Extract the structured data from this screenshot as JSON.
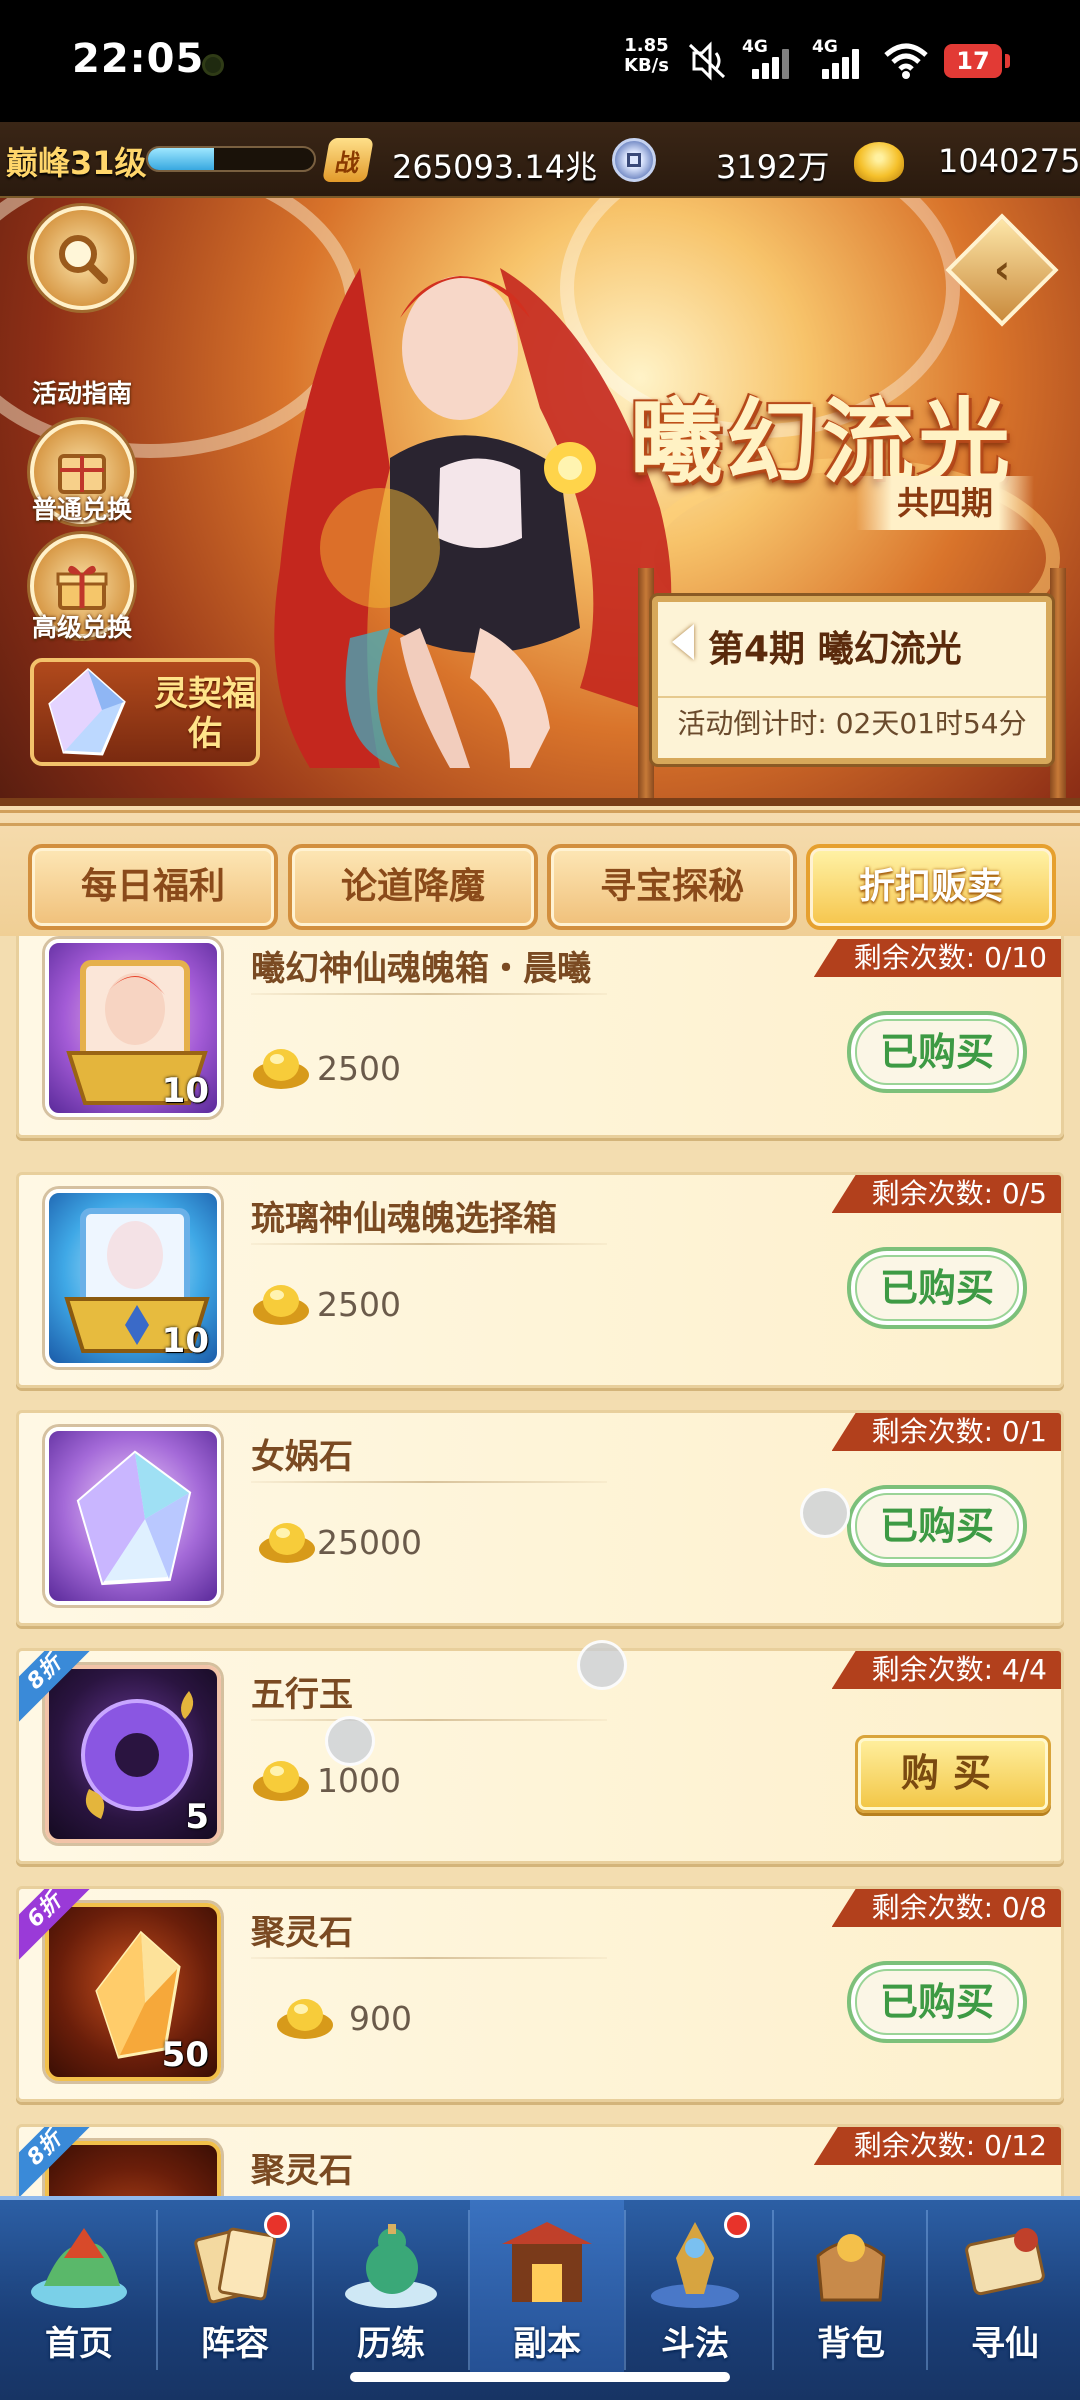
{
  "status_bar": {
    "time": "22:05",
    "net_speed_value": "1.85",
    "net_speed_unit": "KB/s",
    "sim1_label": "4G",
    "sim2_label": "4G",
    "battery": "17"
  },
  "resources": {
    "level": "巅峰31级",
    "exp_fraction": 0.4,
    "power_icon": "战",
    "power": "265093.14兆",
    "silver": "3192万",
    "gold": "1040275"
  },
  "banner": {
    "side_buttons": [
      "活动指南",
      "普通兑换",
      "高级兑换"
    ],
    "lingqi": "灵契福佑",
    "event_title": "曦幻流光",
    "event_sub": "共四期",
    "period_title": "第4期  曦幻流光",
    "countdown": "活动倒计时: 02天01时54分"
  },
  "tabs": [
    "每日福利",
    "论道降魔",
    "寻宝探秘",
    "折扣贩卖"
  ],
  "active_tab": 3,
  "items": [
    {
      "name": "曦幻神仙魂魄箱・晨曦",
      "price": "2500",
      "remain": "剩余次数: 0/10",
      "qty": "10",
      "button": "已购买",
      "discount": ""
    },
    {
      "name": "琉璃神仙魂魄选择箱",
      "price": "2500",
      "remain": "剩余次数: 0/5",
      "qty": "10",
      "button": "已购买",
      "discount": ""
    },
    {
      "name": "女娲石",
      "price": "25000",
      "remain": "剩余次数: 0/1",
      "qty": "",
      "button": "已购买",
      "discount": ""
    },
    {
      "name": "五行玉",
      "price": "1000",
      "remain": "剩余次数: 4/4",
      "qty": "5",
      "button": "购买",
      "discount": "8折"
    },
    {
      "name": "聚灵石",
      "price": "900",
      "remain": "剩余次数: 0/8",
      "qty": "50",
      "button": "已购买",
      "discount": "6折"
    },
    {
      "name": "聚灵石",
      "price": "",
      "remain": "剩余次数: 0/12",
      "qty": "",
      "button": "",
      "discount": "8折"
    }
  ],
  "nav": [
    "首页",
    "阵容",
    "历练",
    "副本",
    "斗法",
    "背包",
    "寻仙"
  ],
  "colors": {
    "remain_badge": "#b2401c",
    "bought_green": "#3d9a44",
    "buy_gold": "#f2c544",
    "nav_blue": "#2c5fa5"
  }
}
